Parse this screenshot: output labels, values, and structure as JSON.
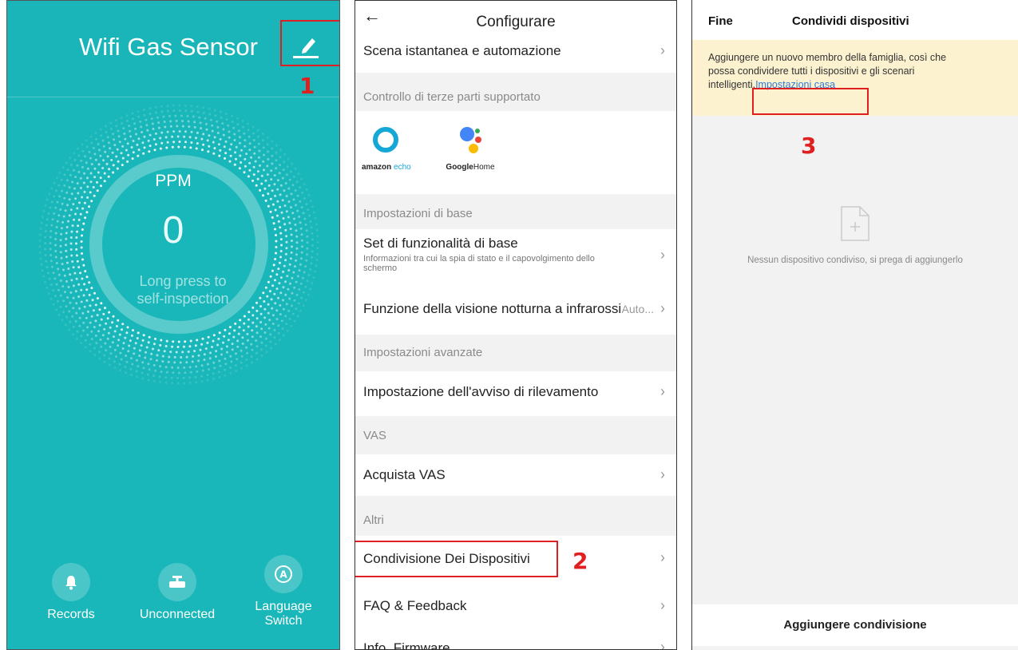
{
  "colors": {
    "teal": "#19b7b9",
    "annotation_red": "#e02020",
    "link_blue": "#2e7bd6",
    "notice_bg": "#fdf2d0"
  },
  "panel1": {
    "title": "Wifi Gas Sensor",
    "edit_icon": "pencil-icon",
    "unit": "PPM",
    "value": "0",
    "hint": "Long press to self-inspection",
    "buttons": [
      {
        "label": "Records",
        "icon": "bell-icon"
      },
      {
        "label": "Unconnected",
        "icon": "valve-icon"
      },
      {
        "label": "Language Switch",
        "icon": "language-a-icon"
      }
    ],
    "annotation": "1"
  },
  "panel2": {
    "title": "Configurare",
    "rows": {
      "scene": "Scena istantanea e automazione",
      "third_party_header": "Controllo di terze parti supportato",
      "amazon_label_1": "amazon",
      "amazon_label_2": "echo",
      "google_label_1": "Google",
      "google_label_2": "Home",
      "basic_header": "Impostazioni di base",
      "basic_set": "Set di funzionalità di base",
      "basic_set_sub": "Informazioni tra cui la spia di stato e il capovolgimento dello schermo",
      "night_vision": "Funzione della visione notturna a infrarossi",
      "night_vision_value": "Auto...",
      "advanced_header": "Impostazioni avanzate",
      "detection_alert": "Impostazione dell'avviso di rilevamento",
      "vas_header": "VAS",
      "buy_vas": "Acquista VAS",
      "others_header": "Altri",
      "device_sharing": "Condivisione Dei Dispositivi",
      "faq": "FAQ & Feedback",
      "firmware": "Info. Firmware"
    },
    "annotation": "2"
  },
  "panel3": {
    "done": "Fine",
    "title": "Condividi dispositivi",
    "notice_text": "Aggiungere un nuovo membro della famiglia, così che possa condividere tutti i dispositivi e gli scenari intelligenti.",
    "notice_link": "Impostazioni casa",
    "empty_text": "Nessun dispositivo condiviso, si prega di aggiungerlo",
    "add_button": "Aggiungere condivisione",
    "annotation": "3"
  }
}
